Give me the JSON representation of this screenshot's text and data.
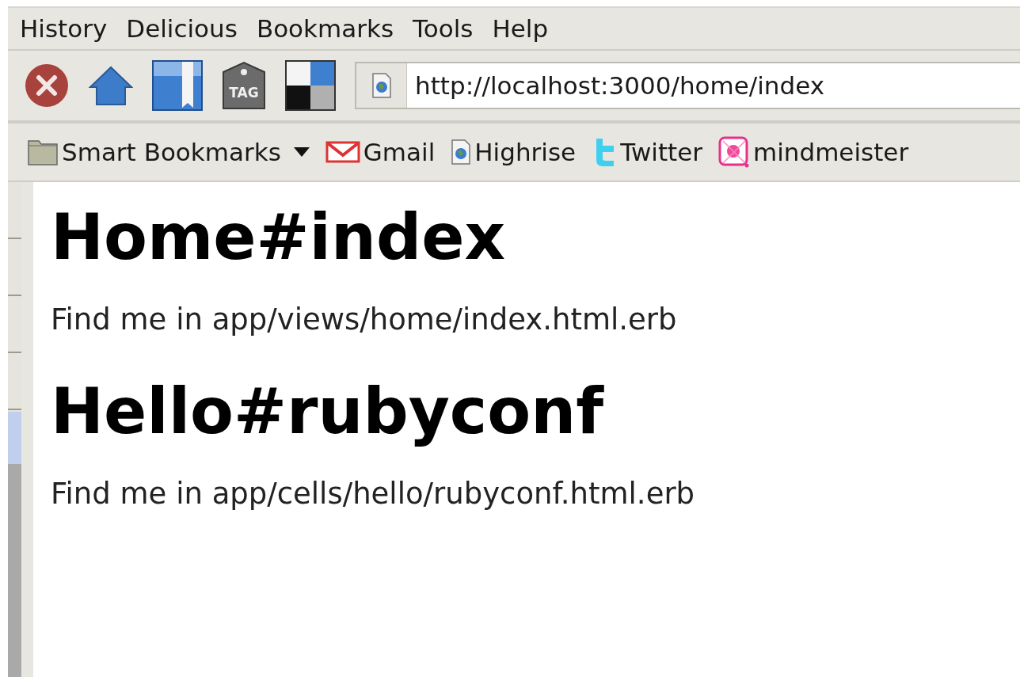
{
  "menu": [
    "History",
    "Delicious",
    "Bookmarks",
    "Tools",
    "Help"
  ],
  "toolbar": {
    "tag_label": "TAG",
    "url": "http://localhost:3000/home/index"
  },
  "bookmarks": [
    {
      "kind": "folder",
      "label": "Smart Bookmarks"
    },
    {
      "kind": "gmail",
      "label": "Gmail"
    },
    {
      "kind": "page",
      "label": "Highrise"
    },
    {
      "kind": "twitter",
      "label": "Twitter"
    },
    {
      "kind": "mindmeister",
      "label": "mindmeister"
    }
  ],
  "content": [
    {
      "kind": "heading",
      "text": "Home#index"
    },
    {
      "kind": "paragraph",
      "text": "Find me in app/views/home/index.html.erb"
    },
    {
      "kind": "heading",
      "text": "Hello#rubyconf"
    },
    {
      "kind": "paragraph",
      "text": "Find me in app/cells/hello/rubyconf.html.erb"
    }
  ]
}
